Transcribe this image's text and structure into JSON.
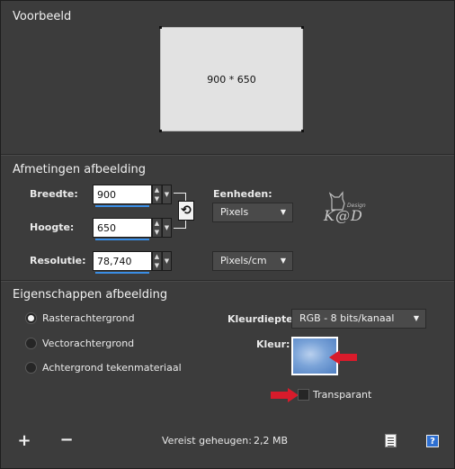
{
  "preview": {
    "title": "Voorbeeld",
    "size_text": "900 * 650"
  },
  "dimensions": {
    "title": "Afmetingen afbeelding",
    "width_label": "Breedte:",
    "width_value": "900",
    "height_label": "Hoogte:",
    "height_value": "650",
    "resolution_label": "Resolutie:",
    "resolution_value": "78,740",
    "units_label": "Eenheden:",
    "units_value": "Pixels",
    "resolution_units_value": "Pixels/cm"
  },
  "properties": {
    "title": "Eigenschappen afbeelding",
    "options": [
      {
        "label": "Rasterachtergrond",
        "selected": true
      },
      {
        "label": "Vectorachtergrond",
        "selected": false
      },
      {
        "label": "Achtergrond tekenmateriaal",
        "selected": false
      }
    ],
    "color_depth_label": "Kleurdiepte:",
    "color_depth_value": "RGB - 8 bits/kanaal",
    "color_label": "Kleur:",
    "transparent_label": "Transparant",
    "transparent_checked": false
  },
  "watermark": {
    "signature": "K@D",
    "small_text": "Design"
  },
  "footer": {
    "add_symbol": "+",
    "remove_symbol": "−",
    "memory_label": "Vereist geheugen:",
    "memory_value": "2,2 MB",
    "help_symbol": "?"
  },
  "colors": {
    "background": "#3c3c3c",
    "accent_underline": "#3a8ee6",
    "swatch_color": "#7aa3d8",
    "arrow_red": "#d81b2b"
  },
  "icons": {
    "link": "link-dimensions-icon",
    "add": "plus-icon",
    "remove": "minus-icon",
    "save_preset": "document-icon",
    "help": "help-icon"
  }
}
